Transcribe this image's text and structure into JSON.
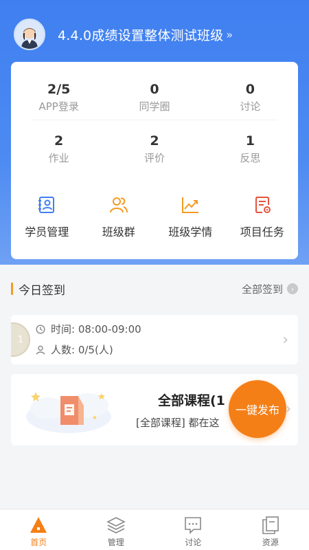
{
  "header": {
    "class_title": "4.4.0成绩设置整体测试班级",
    "chevron": "»"
  },
  "stats": [
    {
      "value": "2/5",
      "label": "APP登录"
    },
    {
      "value": "0",
      "label": "同学圈"
    },
    {
      "value": "0",
      "label": "讨论"
    },
    {
      "value": "2",
      "label": "作业"
    },
    {
      "value": "2",
      "label": "评价"
    },
    {
      "value": "1",
      "label": "反思"
    }
  ],
  "quick_actions": [
    {
      "label": "学员管理",
      "icon": "student-manage-icon",
      "color": "#3f7ff0"
    },
    {
      "label": "班级群",
      "icon": "class-group-icon",
      "color": "#f39b21"
    },
    {
      "label": "班级学情",
      "icon": "learning-trend-icon",
      "color": "#f39b21"
    },
    {
      "label": "项目任务",
      "icon": "project-task-icon",
      "color": "#e5533c"
    }
  ],
  "today_signin": {
    "title": "今日签到",
    "all_link": "全部签到",
    "badge": "1",
    "time": "时间: 08:00-09:00",
    "count": "人数: 0/5(人)"
  },
  "course": {
    "title": "全部课程(1",
    "desc": "[全部课程] 都在这"
  },
  "fab": {
    "label": "一键发布",
    "color": "#f57f17"
  },
  "tabs": [
    {
      "label": "首页",
      "icon": "home-icon",
      "active": true
    },
    {
      "label": "管理",
      "icon": "layers-icon",
      "active": false
    },
    {
      "label": "讨论",
      "icon": "chat-icon",
      "active": false
    },
    {
      "label": "资源",
      "icon": "files-icon",
      "active": false
    }
  ],
  "colors": {
    "brand": "#3f7ff0",
    "accent": "#f57f17"
  }
}
